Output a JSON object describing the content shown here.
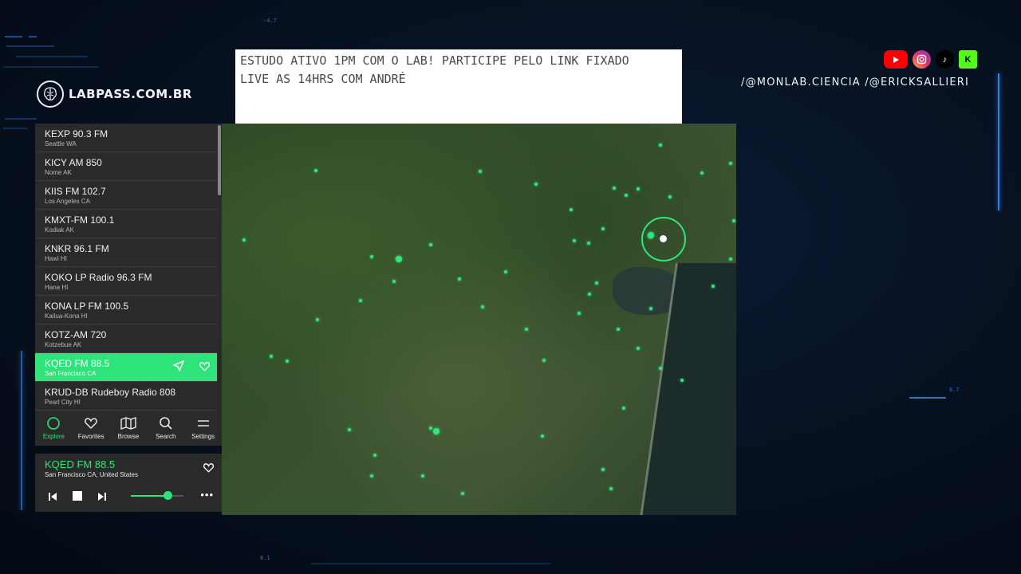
{
  "ticker": {
    "line1": "ESTUDO ATIVO 1PM COM O LAB! PARTICIPE PELO LINK FIXADO",
    "line2": "LIVE AS 14HRS COM ANDRÉ"
  },
  "brand": {
    "name": "LABPASS.COM.BR",
    "icon": "brain-icon"
  },
  "socials": {
    "items": [
      "youtube-icon",
      "instagram-icon",
      "tiktok-icon",
      "kick-icon"
    ],
    "handles": "/@MONLAB.CIENCIA  /@ERICKSALLIERI"
  },
  "stations": [
    {
      "name": "KEXP 90.3 FM",
      "location": "Seattle WA"
    },
    {
      "name": "KICY AM 850",
      "location": "Nome AK"
    },
    {
      "name": "KIIS FM 102.7",
      "location": "Los Angeles CA"
    },
    {
      "name": "KMXT-FM 100.1",
      "location": "Kodiak AK"
    },
    {
      "name": "KNKR 96.1 FM",
      "location": "Hawi HI"
    },
    {
      "name": "KOKO LP Radio 96.3 FM",
      "location": "Hana HI"
    },
    {
      "name": "KONA LP FM 100.5",
      "location": "Kailua-Kona HI"
    },
    {
      "name": "KOTZ-AM 720",
      "location": "Kotzebue AK"
    },
    {
      "name": "KQED FM 88.5",
      "location": "San Francisco CA",
      "active": true
    },
    {
      "name": "KRUD-DB Rudeboy Radio 808",
      "location": "Pearl City HI"
    }
  ],
  "nav": {
    "explore": "Explore",
    "favorites": "Favorites",
    "browse": "Browse",
    "search": "Search",
    "settings": "Settings"
  },
  "player": {
    "station": "KQED FM 88.5",
    "location": "San Francisco CA, United States",
    "volume": 0.7
  },
  "colors": {
    "accent": "#2fe37b",
    "panel": "#2a2a2a",
    "background": "#06101f"
  }
}
